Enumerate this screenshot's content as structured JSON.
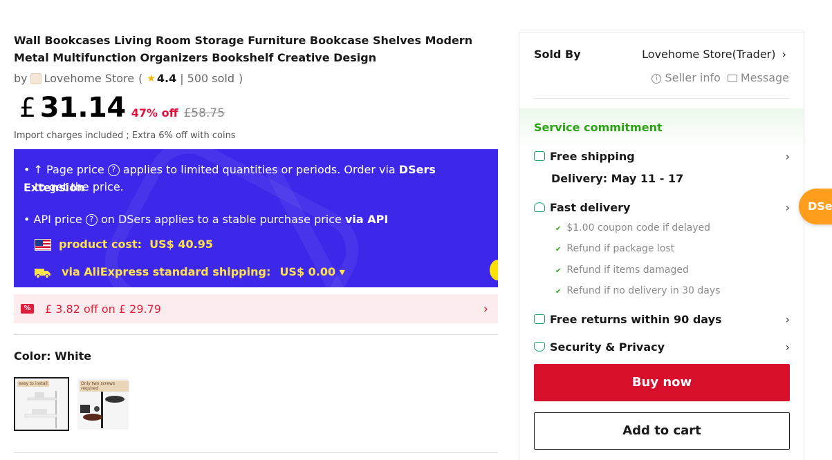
{
  "product": {
    "title": "Wall Bookcases Living Room Storage Furniture Bookcase Shelves Modern Metal Multifunction Organizers Bookshelf Creative Design",
    "by": "by",
    "store": "Lovehome Store",
    "open_paren": "(",
    "rating": "4.4",
    "sep": "|",
    "sold": "500 sold",
    "close_paren": ")",
    "currency": "£",
    "price": "31.14",
    "discount": "47% off",
    "old_price": "£58.75",
    "import_note": "Import charges included ; Extra 6% off with coins"
  },
  "promo": {
    "line1_prefix": "• ↑ Page price",
    "line1_suffix": "applies to limited quantities or periods. Order via",
    "line1_brand": "DSers Extension",
    "line1b": "to get the price.",
    "line2_prefix": "• API price",
    "line2_suffix": "on DSers applies to a stable purchase price",
    "line2_bold": "via API",
    "cost_label": "product cost:",
    "cost_value": "US$ 40.95",
    "shipping_label": "via AliExpress standard shipping:",
    "shipping_value": "US$ 0.00 ▾"
  },
  "coupon": {
    "icon": "%",
    "text": "£ 3.82 off on  £ 29.79",
    "chevron": "›"
  },
  "color": {
    "label": "Color:",
    "value": "White",
    "thumb1_tag": "easy to install",
    "thumb2_tag": "Only two screws required"
  },
  "seller": {
    "sold_by_label": "Sold By",
    "store_name": "Lovehome Store(Trader)",
    "chevron": "›",
    "seller_info": "Seller info",
    "message": "Message"
  },
  "service": {
    "title": "Service commitment",
    "free_shipping": "Free shipping",
    "delivery": "Delivery: May 11 - 17",
    "fast_delivery": "Fast delivery",
    "fast_items": [
      "$1.00 coupon code if delayed",
      "Refund if package lost",
      "Refund if items damaged",
      "Refund if no delivery in 30 days"
    ],
    "free_returns": "Free returns within 90 days",
    "security": "Security & Privacy",
    "chevron": "›"
  },
  "actions": {
    "buy_now": "Buy now",
    "add_to_cart": "Add to cart"
  },
  "extension": {
    "dsers_badge": "DSe"
  },
  "colors": {
    "promo_bg": "#3d28ea",
    "accent_red": "#d80f2a",
    "service_green": "#2aa312",
    "dsers_orange": "#ff9d1c"
  }
}
